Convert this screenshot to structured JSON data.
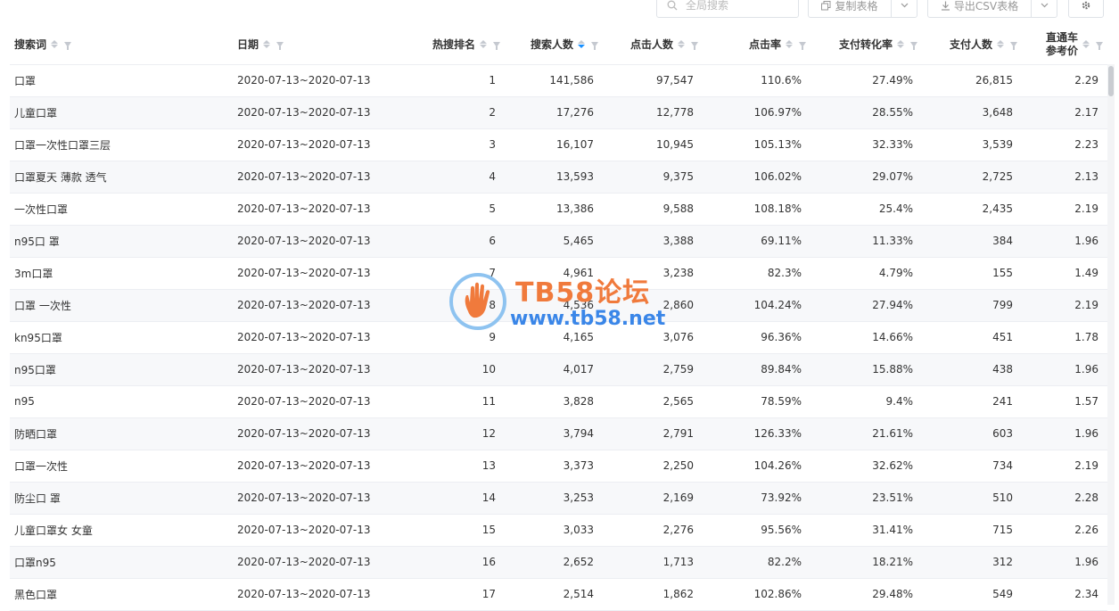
{
  "toolbar": {
    "search_placeholder": "全局搜索",
    "copy_label": "复制表格",
    "csv_label": "导出CSV表格"
  },
  "columns": [
    {
      "key": "keyword",
      "label": "搜索词"
    },
    {
      "key": "date",
      "label": "日期"
    },
    {
      "key": "rank",
      "label": "热搜排名"
    },
    {
      "key": "searchers",
      "label": "搜索人数"
    },
    {
      "key": "clickers",
      "label": "点击人数"
    },
    {
      "key": "ctr",
      "label": "点击率"
    },
    {
      "key": "cvr",
      "label": "支付转化率"
    },
    {
      "key": "payers",
      "label": "支付人数"
    },
    {
      "key": "price_line1",
      "label": "直通车"
    },
    {
      "key": "price_line2",
      "label": "参考价"
    }
  ],
  "rows": [
    {
      "keyword": "口罩",
      "date": "2020-07-13~2020-07-13",
      "rank": "1",
      "searchers": "141,586",
      "clickers": "97,547",
      "ctr": "110.6%",
      "cvr": "27.49%",
      "payers": "26,815",
      "price": "2.29"
    },
    {
      "keyword": "儿童口罩",
      "date": "2020-07-13~2020-07-13",
      "rank": "2",
      "searchers": "17,276",
      "clickers": "12,778",
      "ctr": "106.97%",
      "cvr": "28.55%",
      "payers": "3,648",
      "price": "2.17"
    },
    {
      "keyword": "口罩一次性口罩三层",
      "date": "2020-07-13~2020-07-13",
      "rank": "3",
      "searchers": "16,107",
      "clickers": "10,945",
      "ctr": "105.13%",
      "cvr": "32.33%",
      "payers": "3,539",
      "price": "2.23"
    },
    {
      "keyword": "口罩夏天 薄款 透气",
      "date": "2020-07-13~2020-07-13",
      "rank": "4",
      "searchers": "13,593",
      "clickers": "9,375",
      "ctr": "106.02%",
      "cvr": "29.07%",
      "payers": "2,725",
      "price": "2.13"
    },
    {
      "keyword": "一次性口罩",
      "date": "2020-07-13~2020-07-13",
      "rank": "5",
      "searchers": "13,386",
      "clickers": "9,588",
      "ctr": "108.18%",
      "cvr": "25.4%",
      "payers": "2,435",
      "price": "2.19"
    },
    {
      "keyword": "n95口 罩",
      "date": "2020-07-13~2020-07-13",
      "rank": "6",
      "searchers": "5,465",
      "clickers": "3,388",
      "ctr": "69.11%",
      "cvr": "11.33%",
      "payers": "384",
      "price": "1.96"
    },
    {
      "keyword": "3m口罩",
      "date": "2020-07-13~2020-07-13",
      "rank": "7",
      "searchers": "4,961",
      "clickers": "3,238",
      "ctr": "82.3%",
      "cvr": "4.79%",
      "payers": "155",
      "price": "1.49"
    },
    {
      "keyword": "口罩 一次性",
      "date": "2020-07-13~2020-07-13",
      "rank": "8",
      "searchers": "4,536",
      "clickers": "2,860",
      "ctr": "104.24%",
      "cvr": "27.94%",
      "payers": "799",
      "price": "2.19"
    },
    {
      "keyword": "kn95口罩",
      "date": "2020-07-13~2020-07-13",
      "rank": "9",
      "searchers": "4,165",
      "clickers": "3,076",
      "ctr": "96.36%",
      "cvr": "14.66%",
      "payers": "451",
      "price": "1.78"
    },
    {
      "keyword": "n95口罩",
      "date": "2020-07-13~2020-07-13",
      "rank": "10",
      "searchers": "4,017",
      "clickers": "2,759",
      "ctr": "89.84%",
      "cvr": "15.88%",
      "payers": "438",
      "price": "1.96"
    },
    {
      "keyword": "n95",
      "date": "2020-07-13~2020-07-13",
      "rank": "11",
      "searchers": "3,828",
      "clickers": "2,565",
      "ctr": "78.59%",
      "cvr": "9.4%",
      "payers": "241",
      "price": "1.57"
    },
    {
      "keyword": "防晒口罩",
      "date": "2020-07-13~2020-07-13",
      "rank": "12",
      "searchers": "3,794",
      "clickers": "2,791",
      "ctr": "126.33%",
      "cvr": "21.61%",
      "payers": "603",
      "price": "1.96"
    },
    {
      "keyword": "口罩一次性",
      "date": "2020-07-13~2020-07-13",
      "rank": "13",
      "searchers": "3,373",
      "clickers": "2,250",
      "ctr": "104.26%",
      "cvr": "32.62%",
      "payers": "734",
      "price": "2.19"
    },
    {
      "keyword": "防尘口 罩",
      "date": "2020-07-13~2020-07-13",
      "rank": "14",
      "searchers": "3,253",
      "clickers": "2,169",
      "ctr": "73.92%",
      "cvr": "23.51%",
      "payers": "510",
      "price": "2.28"
    },
    {
      "keyword": "儿童口罩女 女童",
      "date": "2020-07-13~2020-07-13",
      "rank": "15",
      "searchers": "3,033",
      "clickers": "2,276",
      "ctr": "95.56%",
      "cvr": "31.41%",
      "payers": "715",
      "price": "2.26"
    },
    {
      "keyword": "口罩n95",
      "date": "2020-07-13~2020-07-13",
      "rank": "16",
      "searchers": "2,652",
      "clickers": "1,713",
      "ctr": "82.2%",
      "cvr": "18.21%",
      "payers": "312",
      "price": "1.96"
    },
    {
      "keyword": "黑色口罩",
      "date": "2020-07-13~2020-07-13",
      "rank": "17",
      "searchers": "2,514",
      "clickers": "1,862",
      "ctr": "102.86%",
      "cvr": "29.48%",
      "payers": "549",
      "price": "2.34"
    }
  ],
  "watermark": {
    "title": "TB58论坛",
    "url": "www.tb58.net"
  },
  "icons": {
    "search": "search-icon",
    "copy": "copy-icon",
    "download": "download-icon",
    "chevron": "chevron-down-icon",
    "gear": "gear-icon",
    "filter": "filter-icon",
    "sort": "sort-icon"
  },
  "colors": {
    "sort_active": "#1890ff",
    "row_alt": "#f7f8fa",
    "watermark_title": "#f07a3c",
    "watermark_url": "#3a86e8"
  }
}
